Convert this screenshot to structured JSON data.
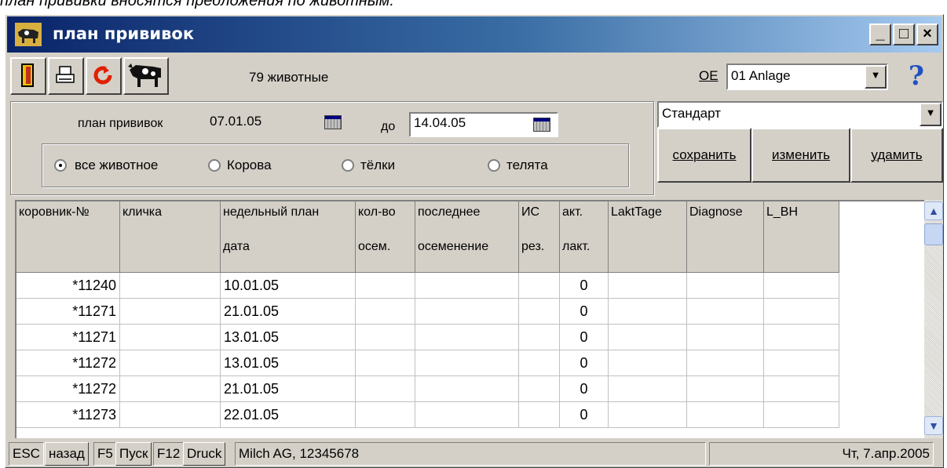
{
  "doc_caption": "план прививки вносятся предложения по животным.",
  "window": {
    "title": "план прививок",
    "min_label": "_",
    "max_label": "□",
    "close_label": "×"
  },
  "toolbar": {
    "animal_count_text": "79  животные",
    "oe_label": "OE",
    "oe_value": "01 Anlage",
    "help_label": "?"
  },
  "filter": {
    "plan_label": "план прививок",
    "date_from": "07.01.05",
    "to_label": "до",
    "date_to": "14.04.05",
    "radios": [
      {
        "label": "все животное",
        "checked": true
      },
      {
        "label": "Корова",
        "checked": false
      },
      {
        "label": "тёлки",
        "checked": false
      },
      {
        "label": "телята",
        "checked": false
      }
    ]
  },
  "profile": {
    "selected": "Стандарт",
    "save_label": "сохранить",
    "edit_label": "изменить",
    "delete_label": "удамить"
  },
  "table": {
    "headers": [
      {
        "l1": "коровник-№",
        "l2": ""
      },
      {
        "l1": "кличка",
        "l2": ""
      },
      {
        "l1": "недельный план",
        "l2": "дата"
      },
      {
        "l1": "кол-во",
        "l2": "осем."
      },
      {
        "l1": "последнее",
        "l2": "осеменение"
      },
      {
        "l1": "ИС",
        "l2": "рез."
      },
      {
        "l1": "акт.",
        "l2": "лакт."
      },
      {
        "l1": "LaktTage",
        "l2": ""
      },
      {
        "l1": "Diagnose",
        "l2": ""
      },
      {
        "l1": "L_BH",
        "l2": ""
      }
    ],
    "rows": [
      [
        "*11240",
        "",
        "10.01.05",
        "",
        "",
        "",
        "0",
        "",
        "",
        ""
      ],
      [
        "*11271",
        "",
        "21.01.05",
        "",
        "",
        "",
        "0",
        "",
        "",
        ""
      ],
      [
        "*11271",
        "",
        "13.01.05",
        "",
        "",
        "",
        "0",
        "",
        "",
        ""
      ],
      [
        "*11272",
        "",
        "13.01.05",
        "",
        "",
        "",
        "0",
        "",
        "",
        ""
      ],
      [
        "*11272",
        "",
        "21.01.05",
        "",
        "",
        "",
        "0",
        "",
        "",
        ""
      ],
      [
        "*11273",
        "",
        "22.01.05",
        "",
        "",
        "",
        "0",
        "",
        "",
        ""
      ]
    ]
  },
  "statusbar": {
    "esc": "ESC",
    "back": "назад",
    "f5": "F5",
    "start": "Пуск",
    "f12": "F12",
    "druck": "Druck",
    "company": "Milch AG, 12345678",
    "date": "Чт, 7.апр.2005"
  },
  "icons": {
    "exit": "exit-door-icon",
    "print": "printer-icon",
    "refresh": "refresh-icon",
    "animal": "cow-icon",
    "calendar": "calendar-icon",
    "help": "help-icon",
    "title": "cow-icon"
  },
  "colors": {
    "title_start": "#0a246a",
    "title_end": "#a6caf0",
    "face": "#d4d0c8"
  }
}
